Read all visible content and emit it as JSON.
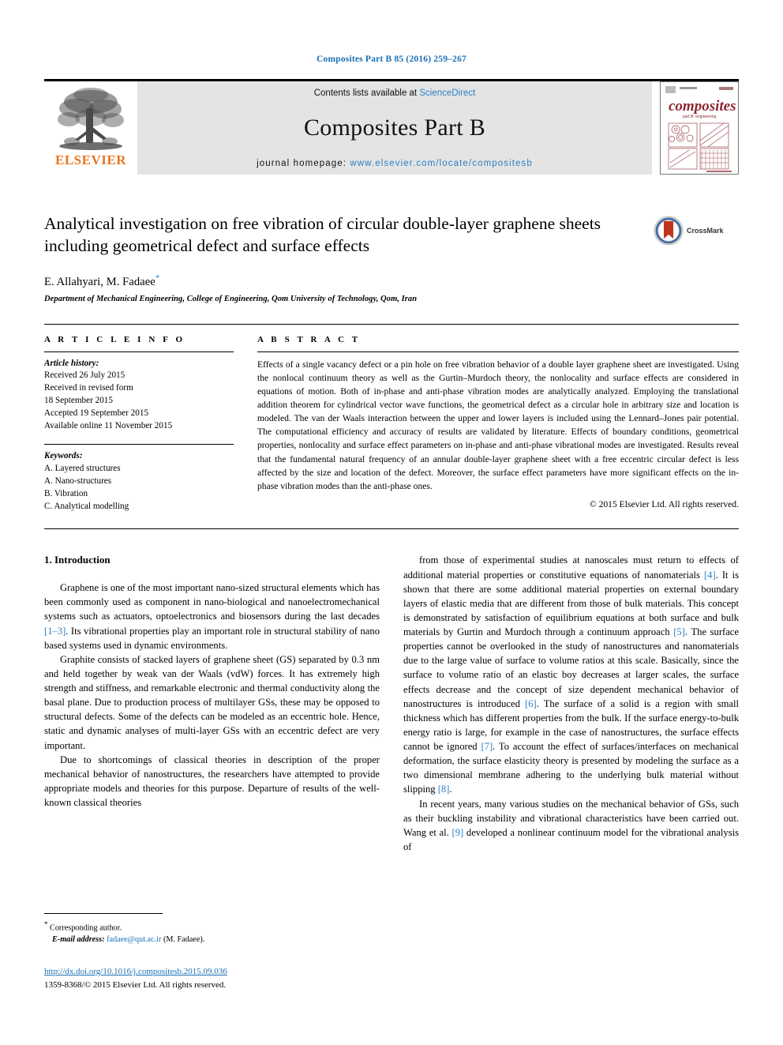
{
  "running_head": "Composites Part B 85 (2016) 259–267",
  "masthead": {
    "publisher": "ELSEVIER",
    "contents_prefix": "Contents lists available at ",
    "contents_link": "ScienceDirect",
    "journal_title": "Composites Part B",
    "homepage_prefix": "journal homepage: ",
    "homepage_url": "www.elsevier.com/locate/compositesb",
    "cover_word": "composites",
    "cover_subtitle": "part B: engineering"
  },
  "article": {
    "title": "Analytical investigation on free vibration of circular double-layer graphene sheets including geometrical defect and surface effects",
    "authors": "E. Allahyari, M. Fadaee",
    "author_marker": "*",
    "affiliation": "Department of Mechanical Engineering, College of Engineering, Qom University of Technology, Qom, Iran",
    "crossmark_label": "CrossMark"
  },
  "article_info": {
    "heading": "A R T I C L E   I N F O",
    "history_label": "Article history:",
    "history": [
      "Received 26 July 2015",
      "Received in revised form",
      "18 September 2015",
      "Accepted 19 September 2015",
      "Available online 11 November 2015"
    ],
    "keywords_label": "Keywords:",
    "keywords": [
      "A. Layered structures",
      "A. Nano-structures",
      "B. Vibration",
      "C. Analytical modelling"
    ]
  },
  "abstract": {
    "heading": "A B S T R A C T",
    "text": "Effects of a single vacancy defect or a pin hole on free vibration behavior of a double layer graphene sheet are investigated. Using the nonlocal continuum theory as well as the Gurtin–Murdoch theory, the nonlocality and surface effects are considered in equations of motion. Both of in-phase and anti-phase vibration modes are analytically analyzed. Employing the translational addition theorem for cylindrical vector wave functions, the geometrical defect as a circular hole in arbitrary size and location is modeled. The van der Waals interaction between the upper and lower layers is included using the Lennard–Jones pair potential. The computational efficiency and accuracy of results are validated by literature. Effects of boundary conditions, geometrical properties, nonlocality and surface effect parameters on in-phase and anti-phase vibrational modes are investigated. Results reveal that the fundamental natural frequency of an annular double-layer graphene sheet with a free eccentric circular defect is less affected by the size and location of the defect. Moreover, the surface effect parameters have more significant effects on the in-phase vibration modes than the anti-phase ones.",
    "copyright": "© 2015 Elsevier Ltd. All rights reserved."
  },
  "introduction": {
    "section_number": "1.",
    "section_title": "Introduction",
    "left_p1_a": "Graphene is one of the most important nano-sized structural elements which has been commonly used as component in nano-biological and nanoelectromechanical systems such as actuators, optoelectronics and biosensors during the last decades ",
    "left_p1_ref": "[1–3]",
    "left_p1_b": ". Its vibrational properties play an important role in structural stability of nano based systems used in dynamic environments.",
    "left_p2": "Graphite consists of stacked layers of graphene sheet (GS) separated by 0.3 nm and held together by weak van der Waals (vdW) forces. It has extremely high strength and stiffness, and remarkable electronic and thermal conductivity along the basal plane. Due to production process of multilayer GSs, these may be opposed to structural defects. Some of the defects can be modeled as an eccentric hole. Hence, static and dynamic analyses of multi-layer GSs with an eccentric defect are very important.",
    "left_p3": "Due to shortcomings of classical theories in description of the proper mechanical behavior of nanostructures, the researchers have attempted to provide appropriate models and theories for this purpose. Departure of results of the well-known classical theories",
    "right_p1_a": "from those of experimental studies at nanoscales must return to effects of additional material properties or constitutive equations of nanomaterials ",
    "right_p1_ref1": "[4]",
    "right_p1_b": ". It is shown that there are some additional material properties on external boundary layers of elastic media that are different from those of bulk materials. This concept is demonstrated by satisfaction of equilibrium equations at both surface and bulk materials by Gurtin and Murdoch through a continuum approach ",
    "right_p1_ref2": "[5]",
    "right_p1_c": ". The surface properties cannot be overlooked in the study of nanostructures and nanomaterials due to the large value of surface to volume ratios at this scale. Basically, since the surface to volume ratio of an elastic boy decreases at larger scales, the surface effects decrease and the concept of size dependent mechanical behavior of nanostructures is introduced ",
    "right_p1_ref3": "[6]",
    "right_p1_d": ". The surface of a solid is a region with small thickness which has different properties from the bulk. If the surface energy-to-bulk energy ratio is large, for example in the case of nanostructures, the surface effects cannot be ignored ",
    "right_p1_ref4": "[7]",
    "right_p1_e": ". To account the effect of surfaces/interfaces on mechanical deformation, the surface elasticity theory is presented by modeling the surface as a two dimensional membrane adhering to the underlying bulk material without slipping ",
    "right_p1_ref5": "[8]",
    "right_p1_f": ".",
    "right_p2_a": "In recent years, many various studies on the mechanical behavior of GSs, such as their buckling instability and vibrational characteristics have been carried out. Wang et al. ",
    "right_p2_ref": "[9]",
    "right_p2_b": " developed a nonlinear continuum model for the vibrational analysis of"
  },
  "footnote": {
    "star": "*",
    "corresponding": "Corresponding author.",
    "email_label": "E-mail address:",
    "email": "fadaee@qut.ac.ir",
    "email_suffix": "(M. Fadaee)."
  },
  "doi_block": {
    "doi": "http://dx.doi.org/10.1016/j.compositesb.2015.09.036",
    "issn_line": "1359-8368/© 2015 Elsevier Ltd. All rights reserved."
  }
}
